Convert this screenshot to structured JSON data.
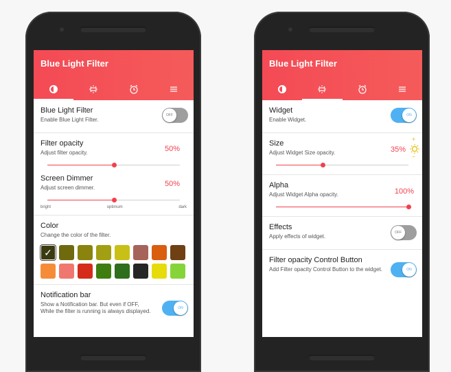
{
  "colors": {
    "appbar": "#f44a55",
    "accent": "#f0424d",
    "toggle_on": "#4fb1f2",
    "toggle_off": "#9e9e9e"
  },
  "left": {
    "title": "Blue Light Filter",
    "tabs": [
      {
        "icon": "brightness-icon",
        "active": true
      },
      {
        "icon": "widget-icon",
        "active": false
      },
      {
        "icon": "alarm-icon",
        "active": false
      },
      {
        "icon": "menu-icon",
        "active": false
      }
    ],
    "filter": {
      "title": "Blue Light Filter",
      "sub": "Enable Blue Light Filter.",
      "toggle": "OFF",
      "on": false
    },
    "opacity": {
      "title": "Filter opacity",
      "sub": "Adjust filter opacity.",
      "value": "50%",
      "level": 0.5
    },
    "dimmer": {
      "title": "Screen Dimmer",
      "sub": "Adjust screen dimmer.",
      "value": "50%",
      "level": 0.5,
      "scale": [
        "bright",
        "optimum",
        "dark"
      ]
    },
    "color": {
      "title": "Color",
      "sub": "Change the color of the filter.",
      "swatches": [
        "#3b3b10",
        "#6f6a0e",
        "#8a830d",
        "#a39f13",
        "#c9c017",
        "#a6635a",
        "#d95e10",
        "#6e4013",
        "#f58d38",
        "#f0776f",
        "#d42b1a",
        "#3f7d10",
        "#2e6e1c",
        "#262626",
        "#e6dc0c",
        "#86d43a"
      ],
      "selected": 0
    },
    "notification": {
      "title": "Notification bar",
      "sub": "Show a Notification bar. But even if OFF, While the filter is running is always displayed.",
      "toggle": "ON",
      "on": true
    }
  },
  "right": {
    "title": "Blue Light Filter",
    "tabs": [
      {
        "icon": "brightness-icon",
        "active": false
      },
      {
        "icon": "widget-icon",
        "active": true
      },
      {
        "icon": "alarm-icon",
        "active": false
      },
      {
        "icon": "menu-icon",
        "active": false
      }
    ],
    "widget": {
      "title": "Widget",
      "sub": "Enable Widget.",
      "toggle": "ON",
      "on": true
    },
    "size": {
      "title": "Size",
      "sub": "Adjust Widget Size opacity.",
      "value": "35%",
      "level": 0.35,
      "plus": "+",
      "minus": "−"
    },
    "alpha": {
      "title": "Alpha",
      "sub": "Adjust Widget Alpha opacity.",
      "value": "100%",
      "level": 1.0
    },
    "effects": {
      "title": "Effects",
      "sub": "Apply effects of widget.",
      "toggle": "OFF",
      "on": false
    },
    "control": {
      "title": "Filter opacity Control Button",
      "sub": "Add Filter opacity Control Button to the widget.",
      "toggle": "ON",
      "on": true
    }
  }
}
